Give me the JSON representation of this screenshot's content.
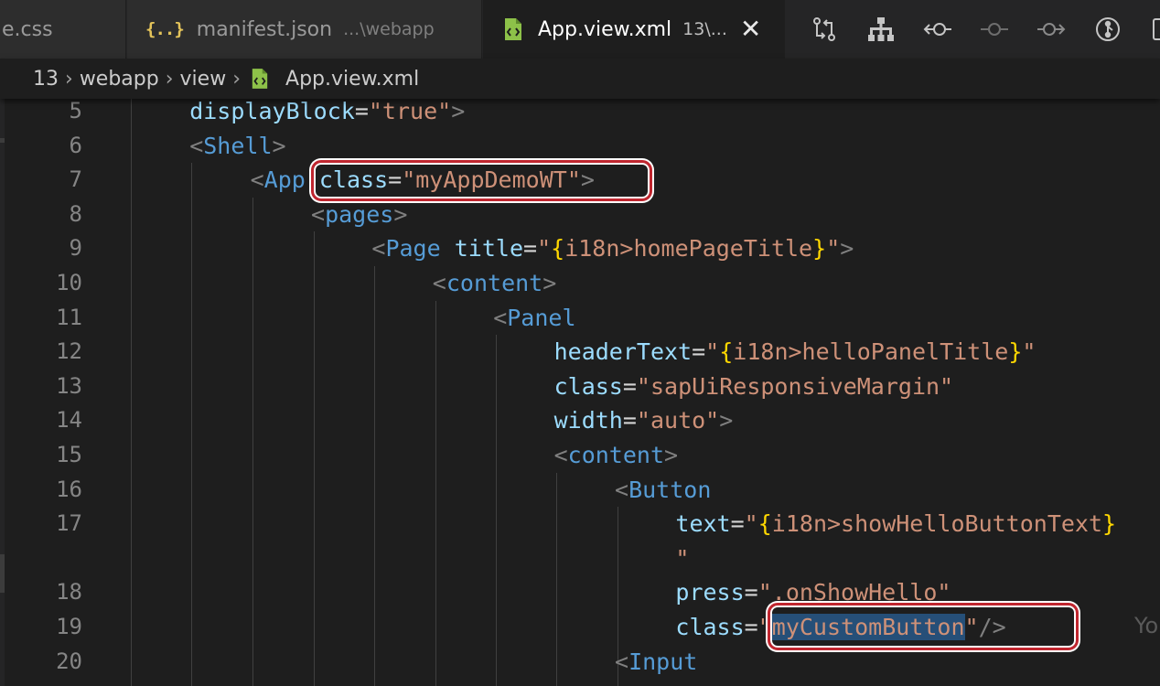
{
  "tabs": [
    {
      "label": "e.css",
      "description": "",
      "icon": "css-icon",
      "active": false
    },
    {
      "label": "manifest.json",
      "description": "...\\webapp",
      "icon": "json-braces-icon",
      "active": false
    },
    {
      "label": "App.view.xml",
      "description": "13\\...",
      "icon": "xml-file-icon",
      "active": true
    }
  ],
  "tab_close_glyph": "✕",
  "json_icon_glyph": "{..}",
  "actions": [
    {
      "name": "compare-changes-icon"
    },
    {
      "name": "hierarchy-icon"
    },
    {
      "name": "go-to-previous-change-icon"
    },
    {
      "name": "toggle-inline-icon"
    },
    {
      "name": "go-to-next-change-icon"
    },
    {
      "name": "git-graph-icon"
    },
    {
      "name": "split-editor-icon"
    }
  ],
  "breadcrumb": {
    "items": [
      "13",
      "webapp",
      "view",
      "App.view.xml"
    ],
    "separator": "›"
  },
  "editor": {
    "lines": [
      {
        "num": "5",
        "tokens": [
          [
            "attr",
            "displayBlock"
          ],
          [
            "plain",
            "="
          ],
          [
            "str",
            "\"true\""
          ],
          [
            "punc",
            ">"
          ]
        ]
      },
      {
        "num": "6",
        "tokens": [
          [
            "punc",
            "<"
          ],
          [
            "tag",
            "Shell"
          ],
          [
            "punc",
            ">"
          ]
        ]
      },
      {
        "num": "7",
        "tokens": [
          [
            "punc",
            "<"
          ],
          [
            "tag",
            "App"
          ],
          [
            "plain",
            " "
          ],
          [
            "attr",
            "class"
          ],
          [
            "plain",
            "="
          ],
          [
            "str",
            "\"myAppDemoWT\""
          ],
          [
            "punc",
            ">"
          ]
        ]
      },
      {
        "num": "8",
        "tokens": [
          [
            "punc",
            "<"
          ],
          [
            "tag",
            "pages"
          ],
          [
            "punc",
            ">"
          ]
        ]
      },
      {
        "num": "9",
        "tokens": [
          [
            "punc",
            "<"
          ],
          [
            "tag",
            "Page"
          ],
          [
            "plain",
            " "
          ],
          [
            "attr",
            "title"
          ],
          [
            "plain",
            "="
          ],
          [
            "str",
            "\""
          ],
          [
            "brace",
            "{"
          ],
          [
            "str",
            "i18n>homePageTitle"
          ],
          [
            "brace",
            "}"
          ],
          [
            "str",
            "\""
          ],
          [
            "punc",
            ">"
          ]
        ]
      },
      {
        "num": "10",
        "tokens": [
          [
            "punc",
            "<"
          ],
          [
            "tag",
            "content"
          ],
          [
            "punc",
            ">"
          ]
        ]
      },
      {
        "num": "11",
        "tokens": [
          [
            "punc",
            "<"
          ],
          [
            "tag",
            "Panel"
          ]
        ]
      },
      {
        "num": "12",
        "tokens": [
          [
            "attr",
            "headerText"
          ],
          [
            "plain",
            "="
          ],
          [
            "str",
            "\""
          ],
          [
            "brace",
            "{"
          ],
          [
            "str",
            "i18n>helloPanelTitle"
          ],
          [
            "brace",
            "}"
          ],
          [
            "str",
            "\""
          ]
        ]
      },
      {
        "num": "13",
        "tokens": [
          [
            "attr",
            "class"
          ],
          [
            "plain",
            "="
          ],
          [
            "str",
            "\"sapUiResponsiveMargin\""
          ]
        ]
      },
      {
        "num": "14",
        "tokens": [
          [
            "attr",
            "width"
          ],
          [
            "plain",
            "="
          ],
          [
            "str",
            "\"auto\""
          ],
          [
            "punc",
            ">"
          ]
        ]
      },
      {
        "num": "15",
        "tokens": [
          [
            "punc",
            "<"
          ],
          [
            "tag",
            "content"
          ],
          [
            "punc",
            ">"
          ]
        ]
      },
      {
        "num": "16",
        "tokens": [
          [
            "punc",
            "<"
          ],
          [
            "tag",
            "Button"
          ]
        ]
      },
      {
        "num": "17",
        "tokens": [
          [
            "attr",
            "text"
          ],
          [
            "plain",
            "="
          ],
          [
            "str",
            "\""
          ],
          [
            "brace",
            "{"
          ],
          [
            "str",
            "i18n>showHelloButtonText"
          ],
          [
            "brace",
            "}"
          ]
        ]
      },
      {
        "num": "",
        "tokens": [
          [
            "str",
            "\""
          ]
        ]
      },
      {
        "num": "18",
        "tokens": [
          [
            "attr",
            "press"
          ],
          [
            "plain",
            "="
          ],
          [
            "str",
            "\".onShowHello\""
          ]
        ]
      },
      {
        "num": "19",
        "tokens": [
          [
            "attr",
            "class"
          ],
          [
            "plain",
            "="
          ],
          [
            "str",
            "\""
          ],
          [
            "sel",
            "myCustomButton"
          ],
          [
            "str",
            "\""
          ],
          [
            "punc",
            "/>"
          ]
        ]
      },
      {
        "num": "20",
        "tokens": [
          [
            "punc",
            "<"
          ],
          [
            "tag",
            "Input"
          ]
        ]
      }
    ],
    "ghost_text": "Yo"
  },
  "colors": {
    "tag": "#569cd6",
    "attribute": "#9cdcfe",
    "string": "#ce9178",
    "highlight_box": "#c0262f",
    "selection": "#264f78"
  }
}
